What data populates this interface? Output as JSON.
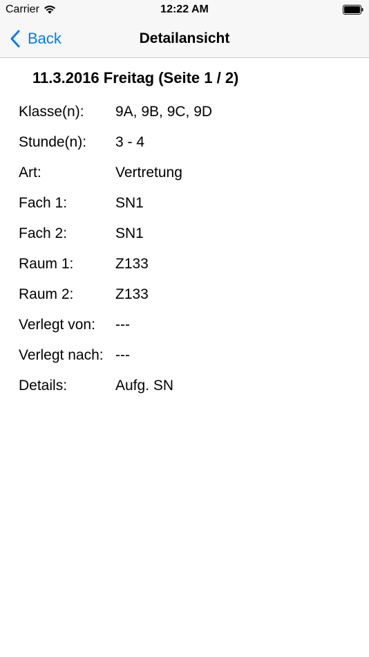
{
  "status_bar": {
    "carrier": "Carrier",
    "time": "12:22 AM"
  },
  "nav": {
    "back_label": "Back",
    "title": "Detailansicht"
  },
  "heading": "11.3.2016 Freitag (Seite 1 / 2)",
  "details": [
    {
      "label": "Klasse(n):",
      "value": "9A, 9B, 9C, 9D"
    },
    {
      "label": "Stunde(n):",
      "value": "3 - 4"
    },
    {
      "label": "Art:",
      "value": "Vertretung"
    },
    {
      "label": "Fach 1:",
      "value": "SN1"
    },
    {
      "label": "Fach 2:",
      "value": "SN1"
    },
    {
      "label": "Raum 1:",
      "value": "Z133"
    },
    {
      "label": "Raum 2:",
      "value": "Z133"
    },
    {
      "label": "Verlegt von:",
      "value": "---"
    },
    {
      "label": "Verlegt nach:",
      "value": "---"
    },
    {
      "label": "Details:",
      "value": "Aufg. SN"
    }
  ],
  "colors": {
    "accent": "#007aff",
    "bar_background": "#f7f7f7",
    "separator": "#c8c7cc"
  },
  "icons": {
    "wifi": "wifi-icon",
    "battery": "battery-icon",
    "back": "chevron-left-icon"
  }
}
